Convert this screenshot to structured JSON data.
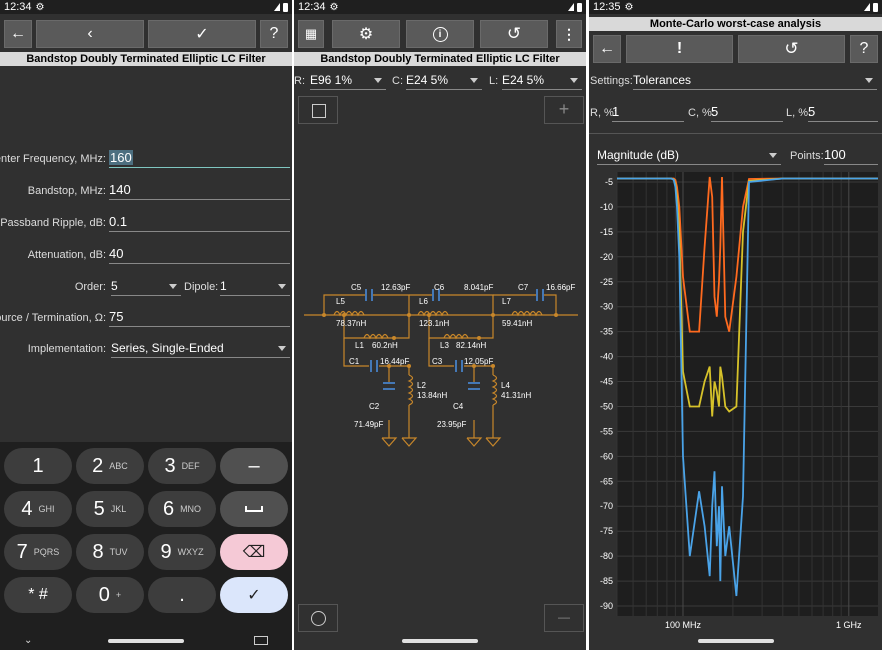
{
  "left": {
    "status": {
      "time": "12:34"
    },
    "toolbar": {
      "back": "‹",
      "back_arrow": "←",
      "ok": "✓",
      "help": "?"
    },
    "title": "Bandstop Doubly Terminated Elliptic LC Filter",
    "fields": {
      "center_freq": {
        "label": "Center Frequency, MHz:",
        "value": "160"
      },
      "bandstop": {
        "label": "Bandstop, MHz:",
        "value": "140"
      },
      "ripple": {
        "label": "Passband Ripple, dB:",
        "value": "0.1"
      },
      "attenuation": {
        "label": "Attenuation, dB:",
        "value": "40"
      },
      "order": {
        "label": "Order:",
        "value": "5"
      },
      "dipole": {
        "label": "Dipole:",
        "value": "1"
      },
      "source": {
        "label": "Source / Termination, Ω:",
        "value": "75"
      },
      "implementation": {
        "label": "Implementation:",
        "value": "Series, Single-Ended"
      }
    },
    "keyboard": {
      "k1": "1",
      "k2": "2",
      "k2l": "ABC",
      "k3": "3",
      "k3l": "DEF",
      "minus": "–",
      "k4": "4",
      "k4l": "GHI",
      "k5": "5",
      "k5l": "JKL",
      "k6": "6",
      "k6l": "MNO",
      "k7": "7",
      "k7l": "PQRS",
      "k8": "8",
      "k8l": "TUV",
      "k9": "9",
      "k9l": "WXYZ",
      "star": "* #",
      "k0": "0",
      "k0l": "+",
      "dot": ".",
      "enter": "✓"
    }
  },
  "middle": {
    "status": {
      "time": "12:34"
    },
    "title": "Bandstop Doubly Terminated Elliptic LC Filter",
    "series": {
      "r": {
        "label": "R:",
        "value": "E96 1%"
      },
      "c": {
        "label": "C:",
        "value": "E24 5%"
      },
      "l": {
        "label": "L:",
        "value": "E24 5%"
      }
    },
    "zoom_in": "+",
    "zoom_out": "—",
    "components": {
      "C5": {
        "name": "C5",
        "value": "12.63pF"
      },
      "C6": {
        "name": "C6",
        "value": "8.041pF"
      },
      "C7": {
        "name": "C7",
        "value": "16.66pF"
      },
      "L5": {
        "name": "L5",
        "value": "78.37nH"
      },
      "L6": {
        "name": "L6",
        "value": "123.1nH"
      },
      "L7": {
        "name": "L7",
        "value": "59.41nH"
      },
      "L1": {
        "name": "L1",
        "value": "60.2nH"
      },
      "L3": {
        "name": "L3",
        "value": "82.14nH"
      },
      "C1": {
        "name": "C1",
        "value": "16.44pF"
      },
      "C3": {
        "name": "C3",
        "value": "12.05pF"
      },
      "L2": {
        "name": "L2",
        "value": "13.84nH"
      },
      "L4": {
        "name": "L4",
        "value": "41.31nH"
      },
      "C2": {
        "name": "C2",
        "value": "71.49pF"
      },
      "C4": {
        "name": "C4",
        "value": "23.95pF"
      }
    }
  },
  "right": {
    "status": {
      "time": "12:35"
    },
    "title": "Monte-Carlo worst-case analysis",
    "toolbar": {
      "back": "←",
      "run": "!",
      "reset": "↺",
      "help": "?"
    },
    "settings": {
      "label": "Settings:",
      "value": "Tolerances"
    },
    "tolerances": {
      "r": {
        "label": "R, %:",
        "value": "1"
      },
      "c": {
        "label": "C, %:",
        "value": "5"
      },
      "l": {
        "label": "L, %:",
        "value": "5"
      }
    },
    "mode": {
      "value": "Magnitude (dB)"
    },
    "points": {
      "label": "Points:",
      "value": "100"
    }
  },
  "colors": {
    "panel_bg": "#303030",
    "toolbar_btn": "#5a5a5a",
    "accent": "#c8872a",
    "cap_blue": "#4a90e2",
    "curve_orange": "#ff6a1f",
    "curve_yellow": "#d6c22a",
    "curve_blue": "#4aa3e8"
  },
  "chart_data": {
    "type": "line",
    "title": "",
    "xlabel": "",
    "ylabel": "",
    "x_scale": "log",
    "x_tick_labels": [
      "100 MHz",
      "1 GHz"
    ],
    "y_ticks": [
      -5,
      -10,
      -15,
      -20,
      -25,
      -30,
      -35,
      -40,
      -45,
      -50,
      -55,
      -60,
      -65,
      -70,
      -75,
      -80,
      -85,
      -90
    ],
    "ylim": [
      -92,
      -3
    ],
    "grid": true,
    "series": [
      {
        "color": "#ff6a1f",
        "x": [
          40,
          75,
          85,
          88,
          90,
          92,
          95,
          100,
          110,
          125,
          135,
          145,
          150,
          155,
          160,
          165,
          168,
          172,
          180,
          190,
          210,
          230,
          250,
          400,
          1000,
          1500
        ],
        "y": [
          -4.3,
          -4.3,
          -4.3,
          -4.3,
          -4.6,
          -6,
          -10,
          -24,
          -35,
          -35,
          -18,
          -4,
          -8,
          -28,
          -32,
          -25,
          -18,
          -4,
          -32,
          -35,
          -24,
          -10,
          -4.4,
          -4.3,
          -4.3,
          -4.3
        ]
      },
      {
        "color": "#d6c22a",
        "x": [
          40,
          75,
          85,
          88,
          90,
          92,
          95,
          100,
          110,
          125,
          135,
          145,
          150,
          155,
          160,
          165,
          168,
          172,
          180,
          190,
          210,
          230,
          250,
          400,
          1000,
          1500
        ],
        "y": [
          -4.3,
          -4.3,
          -4.3,
          -4.5,
          -5.5,
          -8,
          -15,
          -43,
          -50,
          -50,
          -45,
          -42,
          -52,
          -45,
          -47,
          -50,
          -42,
          -44,
          -50,
          -51,
          -50,
          -15,
          -4.8,
          -4.3,
          -4.3,
          -4.3
        ]
      },
      {
        "color": "#4aa3e8",
        "x": [
          40,
          75,
          85,
          88,
          90,
          92,
          95,
          100,
          110,
          125,
          135,
          145,
          150,
          155,
          160,
          165,
          168,
          172,
          180,
          190,
          210,
          230,
          250,
          400,
          1000,
          1500
        ],
        "y": [
          -4.3,
          -4.3,
          -4.3,
          -4.6,
          -6,
          -10,
          -20,
          -60,
          -80,
          -67,
          -74,
          -84,
          -70,
          -63,
          -78,
          -70,
          -85,
          -66,
          -80,
          -74,
          -88,
          -68,
          -5,
          -4.3,
          -4.3,
          -4.3
        ]
      }
    ]
  }
}
